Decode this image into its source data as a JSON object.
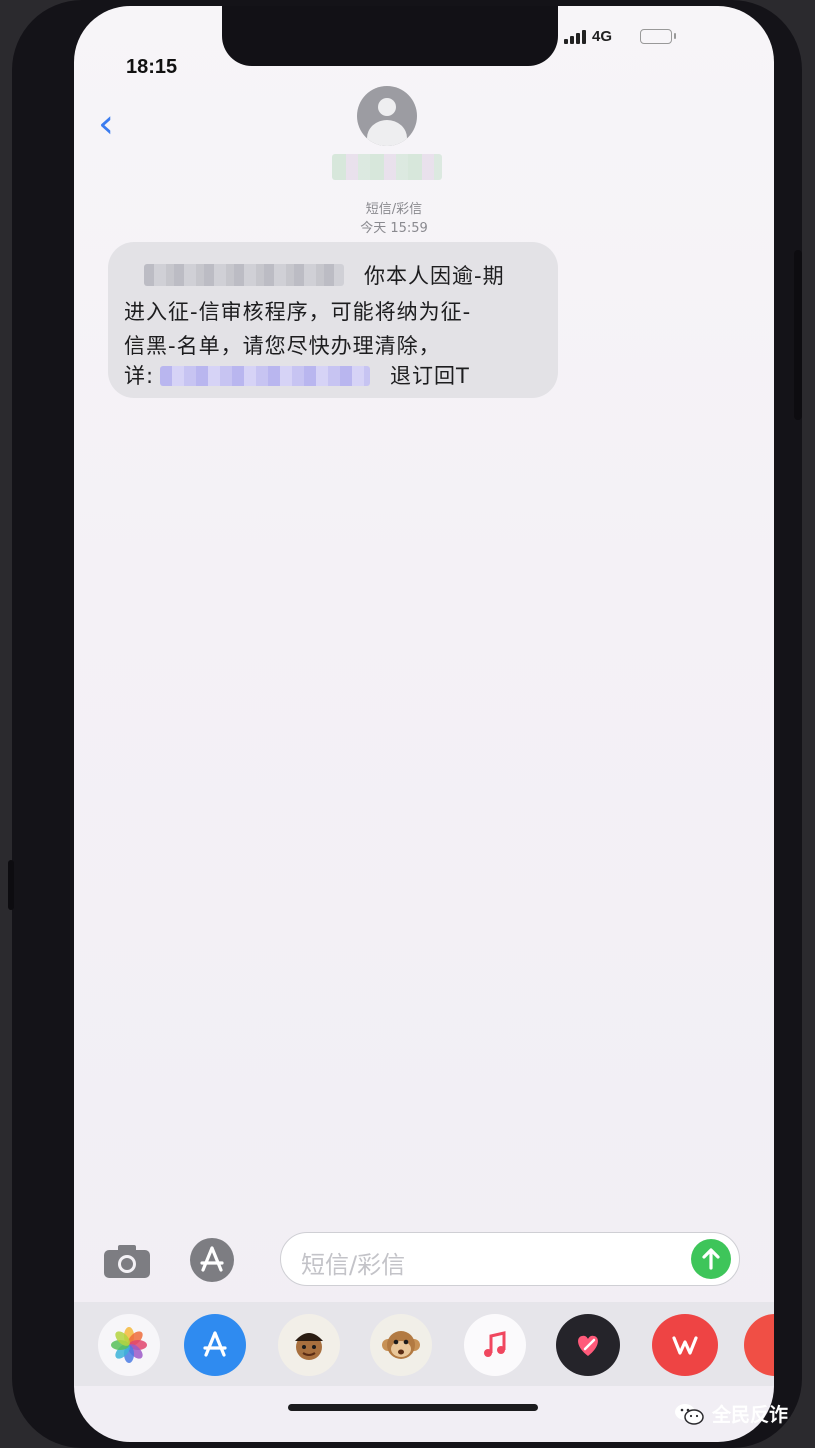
{
  "status_bar": {
    "time": "18:15",
    "network": "4G"
  },
  "header": {
    "back_icon": "chevron-left-icon",
    "avatar_icon": "person-icon"
  },
  "conversation": {
    "message_type": "短信/彩信",
    "timestamp": "今天 15:59",
    "message": {
      "line1": "你本人因逾-期",
      "line2": "进入征-信审核程序，可能将纳为征-",
      "line3": "信黑-名单，请您尽快办理清除，",
      "line4_prefix": "详:",
      "line4_suffix": "退订回T"
    }
  },
  "composer": {
    "camera_icon": "camera-icon",
    "apps_icon": "appstore-icon",
    "placeholder": "短信/彩信",
    "send_icon": "arrow-up-icon"
  },
  "app_drawer": [
    "photos-icon",
    "appstore-icon",
    "memoji-icon",
    "animoji-icon",
    "music-icon",
    "heart-app-icon",
    "wps-icon",
    "app-icon"
  ],
  "watermark": {
    "label": "全民反诈"
  },
  "colors": {
    "accent": "#3b7cf0",
    "send": "#3ec55a",
    "bubble": "#e3e2e6"
  }
}
